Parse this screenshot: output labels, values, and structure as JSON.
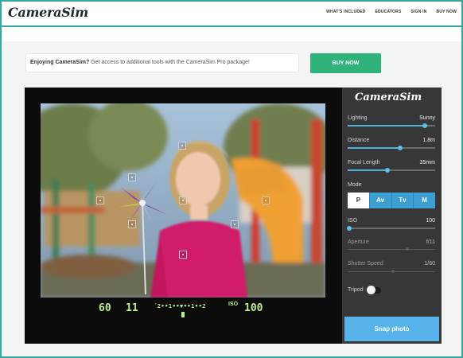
{
  "header": {
    "logo": "CameraSim",
    "nav": [
      "WHAT'S INCLUDED",
      "EDUCATORS",
      "SIGN IN",
      "BUY NOW"
    ]
  },
  "promo": {
    "lead": "Enjoying CameraSim?",
    "text": " Get access to additional tools with the CameraSim Pro package!",
    "button": "BUY NOW"
  },
  "viewfinder": {
    "shutter": "60",
    "aperture": "11",
    "meter": "´2••1••▼••1••2",
    "iso_label": "ISO",
    "iso": "100"
  },
  "panel": {
    "logo": "CameraSim",
    "lighting": {
      "label": "Lighting",
      "value": "Sunny",
      "level": 0.88
    },
    "distance": {
      "label": "Distance",
      "value": "1.8m",
      "level": 0.6
    },
    "focal": {
      "label": "Focal Length",
      "value": "35mm",
      "level": 0.45
    },
    "mode": {
      "label": "Mode",
      "options": [
        "P",
        "Av",
        "Tv",
        "M"
      ],
      "selected": "P"
    },
    "iso": {
      "label": "ISO",
      "value": "100",
      "level": 0.0
    },
    "aperture": {
      "label": "Aperture",
      "value": "f/11",
      "level": 0.68
    },
    "shutter": {
      "label": "Shutter Speed",
      "value": "1/60",
      "level": 0.52
    },
    "tripod": {
      "label": "Tripod",
      "on": false
    },
    "snap": "Snap photo"
  },
  "colors": {
    "brand_teal": "#3aa6a0",
    "buy_green": "#30b27c",
    "slider_blue": "#4fb3e2",
    "lcd_green": "#b9f08a",
    "panel_bg": "#373737"
  }
}
